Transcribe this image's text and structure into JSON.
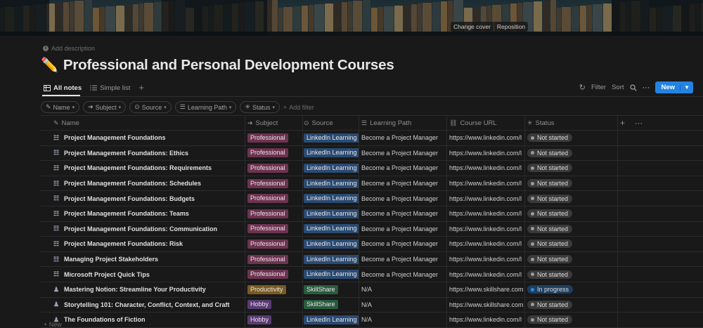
{
  "cover": {
    "change_cover": "Change cover",
    "reposition": "Reposition"
  },
  "header": {
    "add_description": "Add description",
    "title_emoji": "✏️",
    "title": "Professional and Personal Development Courses"
  },
  "views": {
    "tabs": [
      {
        "label": "All notes",
        "icon": "table-icon"
      },
      {
        "label": "Simple list",
        "icon": "list-icon"
      }
    ],
    "toolbar": {
      "filter": "Filter",
      "sort": "Sort",
      "new": "New"
    }
  },
  "filters": [
    {
      "label": "Name",
      "icon": "name-icon"
    },
    {
      "label": "Subject",
      "icon": "arrow-icon"
    },
    {
      "label": "Source",
      "icon": "select-icon"
    },
    {
      "label": "Learning Path",
      "icon": "lines-icon"
    },
    {
      "label": "Status",
      "icon": "status-icon"
    }
  ],
  "add_filter": "Add filter",
  "columns": [
    {
      "label": "Name",
      "icon": "✎"
    },
    {
      "label": "Subject",
      "icon": "➔"
    },
    {
      "label": "Source",
      "icon": "⊙"
    },
    {
      "label": "Learning Path",
      "icon": "☰"
    },
    {
      "label": "Course URL",
      "icon": "⛓"
    },
    {
      "label": "Status",
      "icon": "✳"
    }
  ],
  "rows": [
    {
      "icon": "page-icon",
      "name": "Project Management Foundations",
      "subject": "Professional",
      "source": "LinkedIn Learning",
      "path": "Become a Project Manager",
      "url": "https://www.linkedin.com/l",
      "status": "Not started"
    },
    {
      "icon": "page-icon",
      "name": "Project Management Foundations: Ethics",
      "subject": "Professional",
      "source": "LinkedIn Learning",
      "path": "Become a Project Manager",
      "url": "https://www.linkedin.com/l",
      "status": "Not started"
    },
    {
      "icon": "page-icon",
      "name": "Project Management Foundations: Requirements",
      "subject": "Professional",
      "source": "LinkedIn Learning",
      "path": "Become a Project Manager",
      "url": "https://www.linkedin.com/l",
      "status": "Not started"
    },
    {
      "icon": "page-icon",
      "name": "Project Management Foundations: Schedules",
      "subject": "Professional",
      "source": "LinkedIn Learning",
      "path": "Become a Project Manager",
      "url": "https://www.linkedin.com/l",
      "status": "Not started"
    },
    {
      "icon": "page-icon",
      "name": "Project Management Foundations: Budgets",
      "subject": "Professional",
      "source": "LinkedIn Learning",
      "path": "Become a Project Manager",
      "url": "https://www.linkedin.com/l",
      "status": "Not started"
    },
    {
      "icon": "page-icon",
      "name": "Project Management Foundations: Teams",
      "subject": "Professional",
      "source": "LinkedIn Learning",
      "path": "Become a Project Manager",
      "url": "https://www.linkedin.com/l",
      "status": "Not started"
    },
    {
      "icon": "page-icon",
      "name": "Project Management Foundations: Communication",
      "subject": "Professional",
      "source": "LinkedIn Learning",
      "path": "Become a Project Manager",
      "url": "https://www.linkedin.com/l",
      "status": "Not started"
    },
    {
      "icon": "page-icon",
      "name": "Project Management Foundations: Risk",
      "subject": "Professional",
      "source": "LinkedIn Learning",
      "path": "Become a Project Manager",
      "url": "https://www.linkedin.com/l",
      "status": "Not started"
    },
    {
      "icon": "page-icon",
      "name": "Managing Project Stakeholders",
      "subject": "Professional",
      "source": "LinkedIn Learning",
      "path": "Become a Project Manager",
      "url": "https://www.linkedin.com/l",
      "status": "Not started"
    },
    {
      "icon": "page-icon",
      "name": "Microsoft Project Quick Tips",
      "subject": "Professional",
      "source": "LinkedIn Learning",
      "path": "Become a Project Manager",
      "url": "https://www.linkedin.com/l",
      "status": "Not started"
    },
    {
      "icon": "person-icon",
      "name": "Mastering Notion: Streamline Your Productivity",
      "subject": "Productivity",
      "source": "SkillShare",
      "path": "N/A",
      "url": "https://www.skillshare.com",
      "status": "In progress"
    },
    {
      "icon": "person-icon",
      "name": "Storytelling 101: Character, Conflict, Context, and Craft",
      "subject": "Hobby",
      "source": "SkillShare",
      "path": "N/A",
      "url": "https://www.skillshare.com",
      "status": "Not started"
    },
    {
      "icon": "person-icon",
      "name": "The Foundations of Fiction",
      "subject": "Hobby",
      "source": "LinkedIn Learning",
      "path": "N/A",
      "url": "https://www.linkedin.com/l",
      "status": "Not started"
    }
  ],
  "new_row": "New",
  "colors": {
    "subject": {
      "Professional": "#6e3250",
      "Productivity": "#7a5a22",
      "Hobby": "#5a3a72"
    },
    "source": {
      "LinkedIn Learning": "#2a4a72",
      "SkillShare": "#2a5a3e"
    },
    "status": {
      "Not started": "#3a3a3a",
      "In progress": "#1e3f5f"
    },
    "status_dot": {
      "Not started": "#9b9b9b",
      "In progress": "#2f8ae0"
    },
    "accent": "#2383e2"
  }
}
